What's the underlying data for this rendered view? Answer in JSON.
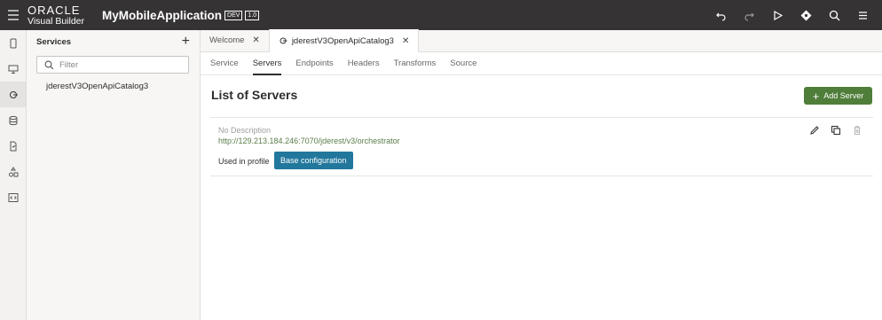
{
  "header": {
    "brand_top": "ORACLE",
    "brand_bottom": "Visual Builder",
    "app_name": "MyMobileApplication",
    "badge_dev": "DEV",
    "badge_version": "1.0"
  },
  "rail": {
    "items": [
      "mobile-device-icon",
      "desktop-icon",
      "services-icon",
      "database-icon",
      "business-rules-icon",
      "components-icon",
      "source-code-icon"
    ],
    "active_index": 2
  },
  "services": {
    "title": "Services",
    "filter_placeholder": "Filter",
    "items": [
      "jderestV3OpenApiCatalog3"
    ]
  },
  "tabs": [
    {
      "label": "Welcome",
      "active": false
    },
    {
      "label": "jderestV3OpenApiCatalog3",
      "active": true
    }
  ],
  "subtabs": [
    "Service",
    "Servers",
    "Endpoints",
    "Headers",
    "Transforms",
    "Source"
  ],
  "subtab_active": "Servers",
  "main": {
    "title": "List of Servers",
    "add_label": "Add Server",
    "server": {
      "description": "No Description",
      "url": "http://129.213.184.246:7070/jderest/v3/orchestrator",
      "used_in_label": "Used in profile",
      "profile": "Base configuration"
    }
  },
  "colors": {
    "topbar": "#353333",
    "add_button": "#4f7d3a",
    "profile_button": "#22779c",
    "url_text": "#5b7e4a"
  }
}
